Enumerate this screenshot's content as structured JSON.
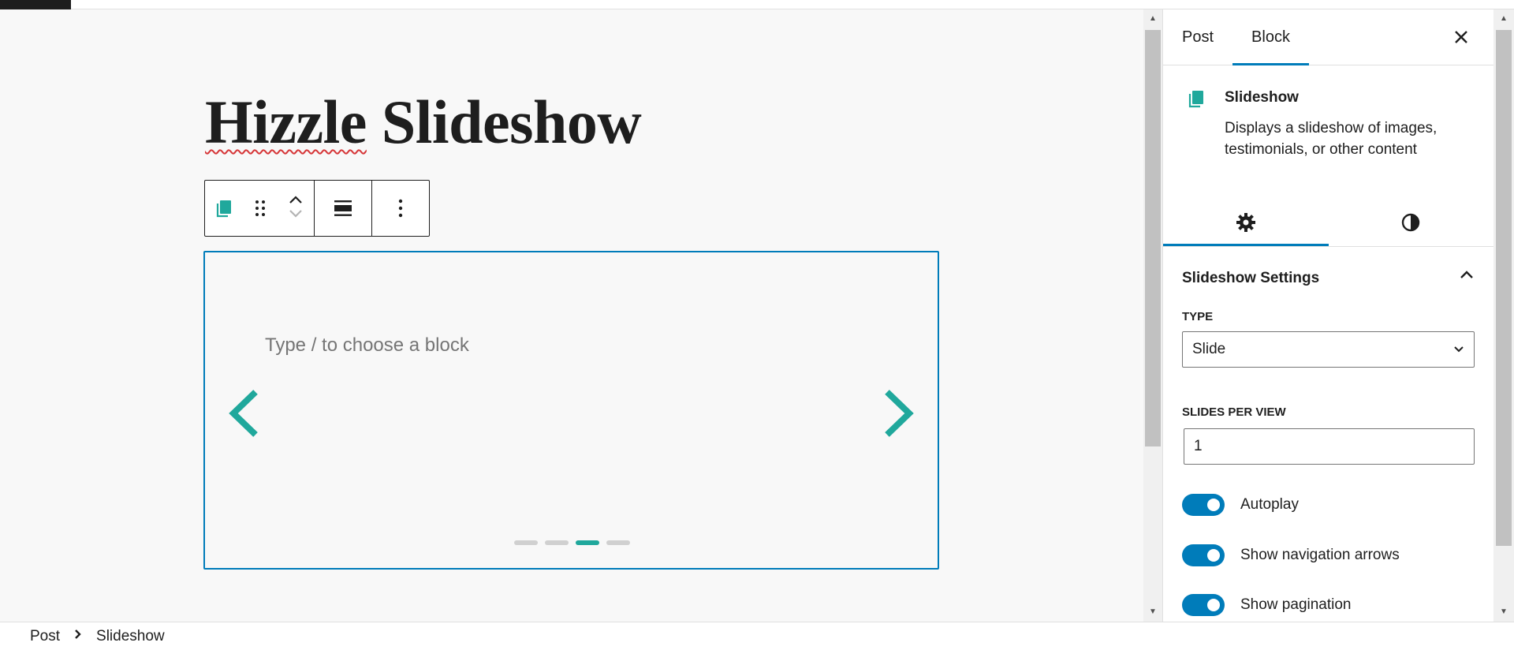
{
  "editor": {
    "post_title_part1": "Hizzle",
    "post_title_part2": " Slideshow",
    "block_placeholder": "Type / to choose a block",
    "slider": {
      "slide_count": 4,
      "active_slide_index": 2,
      "accent_color": "#20a89c"
    }
  },
  "toolbar": {
    "block_icon": "slideshow-block-icon",
    "drag_icon": "drag-handle-icon",
    "move_up_icon": "chevron-up-icon",
    "move_down_icon": "chevron-down-icon",
    "align_icon": "align-wide-icon",
    "more_icon": "more-vertical-icon"
  },
  "breadcrumb": {
    "items": [
      "Post",
      "Slideshow"
    ]
  },
  "sidebar": {
    "tabs": [
      "Post",
      "Block"
    ],
    "active_tab": "Block",
    "close_icon": "close-icon",
    "block": {
      "name": "Slideshow",
      "description": "Displays a slideshow of images, testimonials, or other content"
    },
    "sub_tabs": [
      "settings-gear-icon",
      "styles-contrast-icon"
    ],
    "panel": {
      "title": "Slideshow Settings",
      "type_label": "Type",
      "type_value": "Slide",
      "slides_per_view_label": "Slides per view",
      "slides_per_view_value": "1",
      "toggles": [
        {
          "label": "Autoplay",
          "on": true
        },
        {
          "label": "Show navigation arrows",
          "on": true
        },
        {
          "label": "Show pagination",
          "on": true
        }
      ]
    }
  },
  "colors": {
    "accent": "#007cba",
    "brand_teal": "#20a89c"
  }
}
